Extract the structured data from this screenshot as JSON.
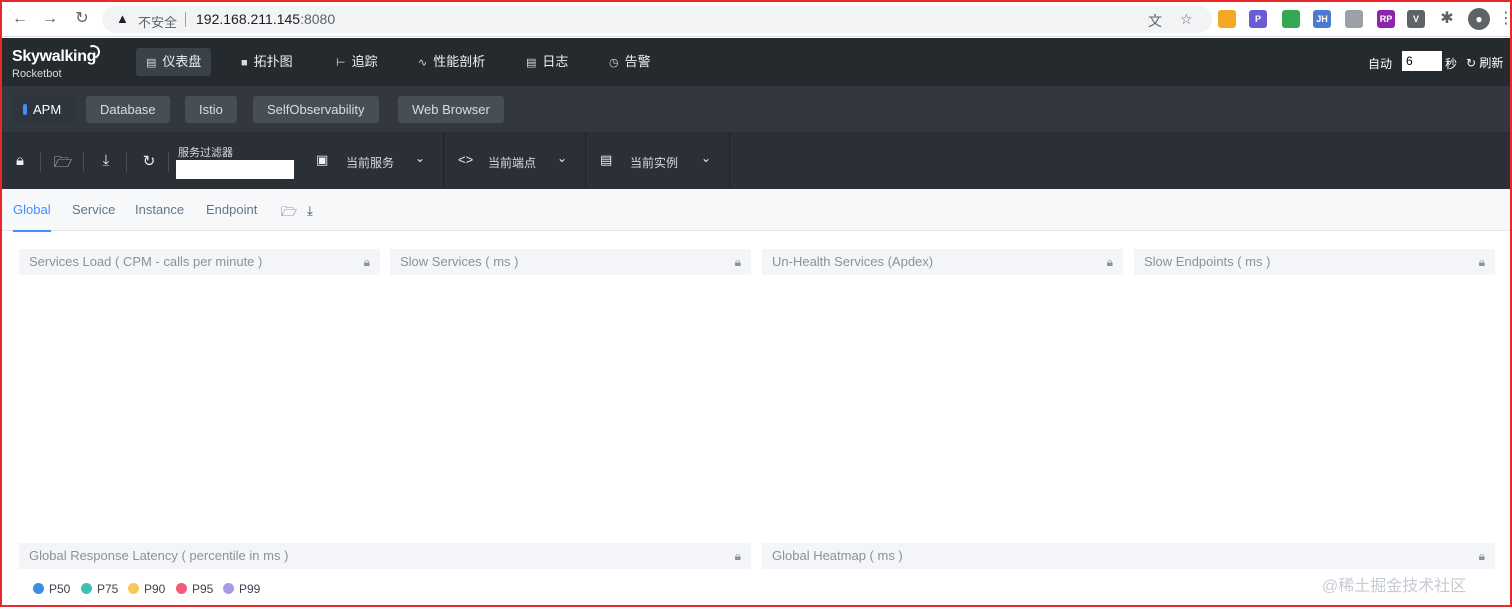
{
  "browser": {
    "security_warning": "不安全",
    "url_host": "192.168.211.145",
    "url_port": ":8080",
    "icons": [
      "back-icon",
      "forward-icon",
      "reload-icon",
      "translate-icon",
      "star-icon",
      "extensions-icon",
      "profile-icon",
      "menu-icon"
    ],
    "extensions": [
      {
        "name": "ext-hand-icon",
        "color": "#f5a623",
        "label": ""
      },
      {
        "name": "ext-search-icon",
        "color": "#6b5bd6",
        "label": "P"
      },
      {
        "name": "ext-colorful-icon",
        "color": "#34a853",
        "label": ""
      },
      {
        "name": "ext-jh-icon",
        "color": "#4a7bd0",
        "label": "JH"
      },
      {
        "name": "ext-gray-icon",
        "color": "#9aa0a6",
        "label": ""
      },
      {
        "name": "ext-rp-icon",
        "color": "#8e24aa",
        "label": "RP"
      },
      {
        "name": "ext-v-icon",
        "color": "#5f6368",
        "label": "V"
      }
    ]
  },
  "logo": {
    "title": "Skywalking",
    "subtitle": "Rocketbot"
  },
  "nav": [
    {
      "label": "仪表盘",
      "icon": "chart-icon",
      "active": true
    },
    {
      "label": "拓扑图",
      "icon": "topology-icon",
      "active": false
    },
    {
      "label": "追踪",
      "icon": "trace-icon",
      "active": false
    },
    {
      "label": "性能剖析",
      "icon": "profile-icon",
      "active": false
    },
    {
      "label": "日志",
      "icon": "log-icon",
      "active": false
    },
    {
      "label": "告警",
      "icon": "alarm-icon",
      "active": false
    }
  ],
  "auto_refresh": {
    "label": "自动",
    "value": "6",
    "unit": "秒",
    "refresh_label": "刷新"
  },
  "layers": [
    "APM",
    "Database",
    "Istio",
    "SelfObservability",
    "Web Browser"
  ],
  "toolbar": {
    "filter_label": "服务过滤器",
    "filter_value": "",
    "selectors": [
      {
        "label": "当前服务",
        "icon": "service-icon"
      },
      {
        "label": "当前端点",
        "icon": "endpoint-icon"
      },
      {
        "label": "当前实例",
        "icon": "instance-icon"
      }
    ]
  },
  "dashboard_tabs": [
    "Global",
    "Service",
    "Instance",
    "Endpoint"
  ],
  "panels": [
    "Services Load ( CPM - calls per minute )",
    "Slow Services ( ms )",
    "Un-Health Services (Apdex)",
    "Slow Endpoints ( ms )",
    "Global Response Latency ( percentile in ms )",
    "Global Heatmap ( ms )"
  ],
  "legend": [
    {
      "label": "P50",
      "color": "#3a8ee6"
    },
    {
      "label": "P75",
      "color": "#3ec1b5"
    },
    {
      "label": "P90",
      "color": "#f7c85a"
    },
    {
      "label": "P95",
      "color": "#ef5d7a"
    },
    {
      "label": "P99",
      "color": "#a59be6"
    }
  ],
  "watermark": "@稀土掘金技术社区"
}
